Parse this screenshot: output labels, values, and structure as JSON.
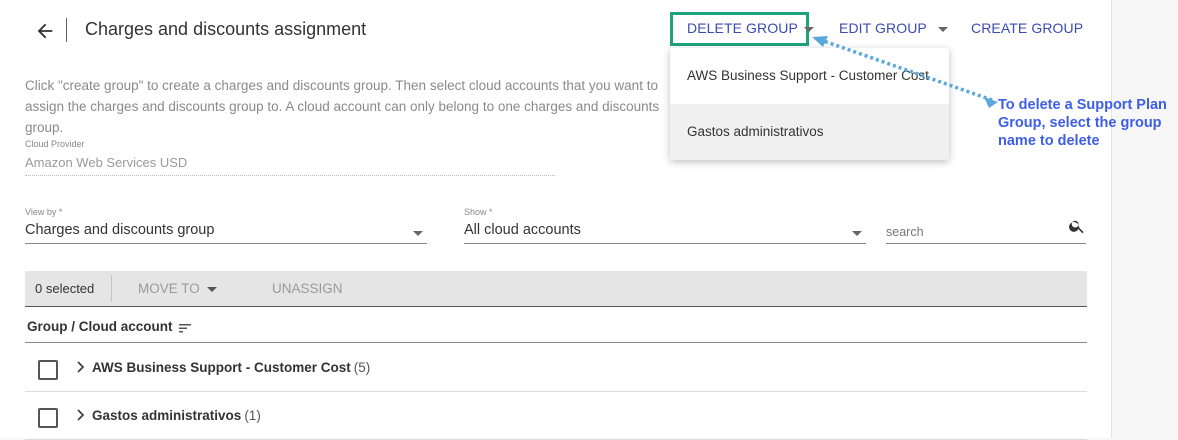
{
  "header": {
    "title": "Charges and discounts assignment",
    "delete_group": "DELETE GROUP",
    "edit_group": "EDIT GROUP",
    "create_group": "CREATE GROUP"
  },
  "description": "Click \"create group\" to create a charges and discounts group. Then select cloud accounts that you want to assign the charges and discounts group to. A cloud account can only belong to one charges and discounts group.",
  "cloud_provider": {
    "label": "Cloud Provider",
    "value": "Amazon Web Services USD"
  },
  "filters": {
    "view_by_label": "View by *",
    "view_by_value": "Charges and discounts group",
    "show_label": "Show *",
    "show_value": "All cloud accounts",
    "search_placeholder": "search"
  },
  "toolbar": {
    "selected": "0 selected",
    "move_to": "MOVE TO",
    "unassign": "UNASSIGN"
  },
  "table": {
    "column_header": "Group / Cloud account",
    "rows": [
      {
        "name": "AWS Business Support - Customer Cost",
        "count": "(5)"
      },
      {
        "name": "Gastos administrativos",
        "count": "(1)"
      }
    ]
  },
  "dropdown": {
    "items": [
      {
        "label": "AWS Business Support - Customer Cost"
      },
      {
        "label": "Gastos administrativos"
      }
    ]
  },
  "annotation": {
    "text": "To delete a Support Plan Group, select the group name to delete"
  },
  "colors": {
    "accent": "#3a4bb5",
    "highlight_box": "#1fa37c",
    "annotation": "#3d5ee8",
    "arrow": "#5aa9dc"
  }
}
